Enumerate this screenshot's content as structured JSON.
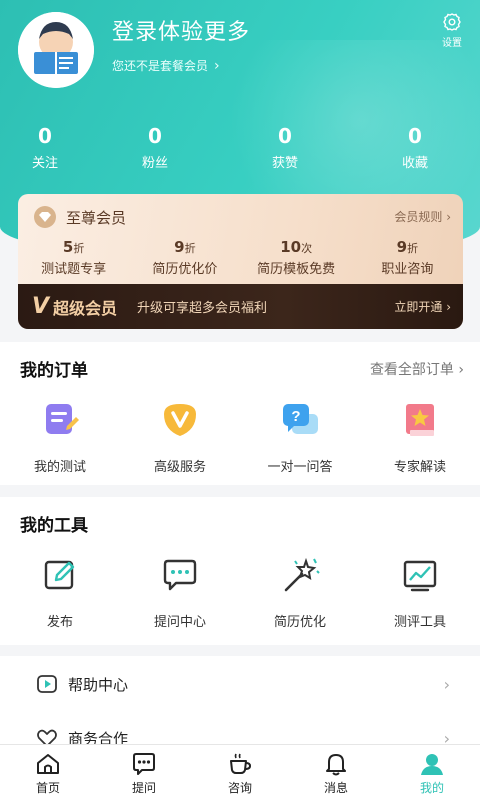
{
  "header": {
    "login_title": "登录体验更多",
    "member_hint": "您还不是套餐会员",
    "settings_label": "设置"
  },
  "stats": [
    {
      "value": "0",
      "label": "关注"
    },
    {
      "value": "0",
      "label": "粉丝"
    },
    {
      "value": "0",
      "label": "获赞"
    },
    {
      "value": "0",
      "label": "收藏"
    }
  ],
  "vip": {
    "title": "至尊会员",
    "rules": "会员规则",
    "benefits": [
      {
        "value": "5",
        "unit": "折",
        "label": "测试题专享"
      },
      {
        "value": "9",
        "unit": "折",
        "label": "简历优化价"
      },
      {
        "value": "10",
        "unit": "次",
        "label": "简历模板免费"
      },
      {
        "value": "9",
        "unit": "折",
        "label": "职业咨询"
      }
    ],
    "super_label": "超级会员",
    "upgrade_text": "升级可享超多会员福利",
    "open_text": "立即开通"
  },
  "orders": {
    "title": "我的订单",
    "more": "查看全部订单",
    "items": [
      {
        "label": "我的测试",
        "icon": "test-icon"
      },
      {
        "label": "高级服务",
        "icon": "vip-service-icon"
      },
      {
        "label": "一对一问答",
        "icon": "qa-icon"
      },
      {
        "label": "专家解读",
        "icon": "expert-icon"
      }
    ]
  },
  "tools": {
    "title": "我的工具",
    "items": [
      {
        "label": "发布",
        "icon": "edit-icon"
      },
      {
        "label": "提问中心",
        "icon": "chat-icon"
      },
      {
        "label": "简历优化",
        "icon": "magic-wand-icon"
      },
      {
        "label": "测评工具",
        "icon": "chart-icon"
      }
    ]
  },
  "list": [
    {
      "label": "帮助中心",
      "icon": "help-icon"
    },
    {
      "label": "商务合作",
      "icon": "handshake-icon"
    }
  ],
  "tabs": [
    {
      "label": "首页",
      "icon": "home-icon"
    },
    {
      "label": "提问",
      "icon": "ask-icon"
    },
    {
      "label": "咨询",
      "icon": "coffee-icon"
    },
    {
      "label": "消息",
      "icon": "bell-icon"
    },
    {
      "label": "我的",
      "icon": "user-icon"
    }
  ],
  "colors": {
    "accent": "#2fc2b5",
    "vip_dark": "#2b1a13",
    "vip_gold": "#f3cfa5"
  }
}
